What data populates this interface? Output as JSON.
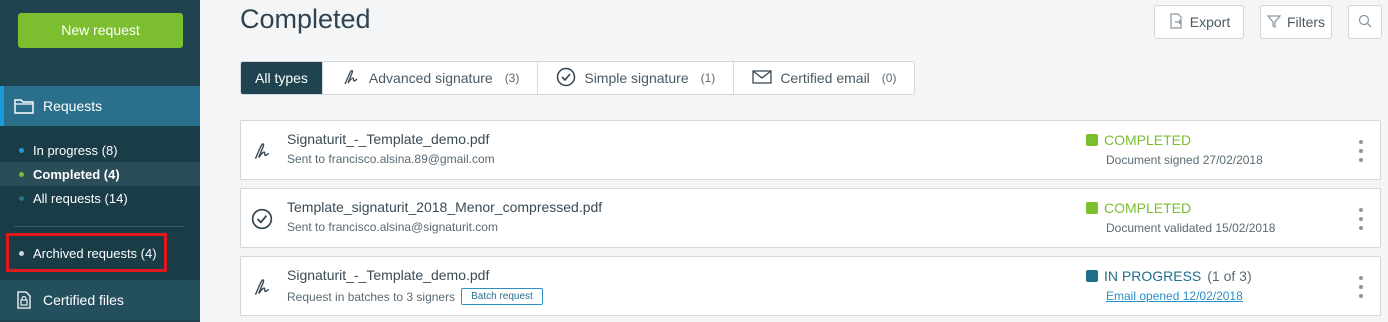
{
  "sidebar": {
    "new_request": "New request",
    "requests_label": "Requests",
    "items": [
      {
        "label": "In progress (8)",
        "dot_color": "#1a9bd7"
      },
      {
        "label": "Completed (4)",
        "dot_color": "#7bbe2f"
      },
      {
        "label": "All requests (14)",
        "dot_color": "#2a6f8c"
      }
    ],
    "archived": {
      "label": "Archived requests (4)",
      "dot_color": "#d0d6da"
    },
    "certified_files": "Certified files"
  },
  "header": {
    "title": "Completed",
    "export_label": "Export",
    "filters_label": "Filters"
  },
  "tabs": [
    {
      "label": "All types",
      "count": "",
      "icon": "all-types"
    },
    {
      "label": "Advanced signature",
      "count": "(3)",
      "icon": "signature-icon"
    },
    {
      "label": "Simple signature",
      "count": "(1)",
      "icon": "check-circle-icon"
    },
    {
      "label": "Certified email",
      "count": "(0)",
      "icon": "envelope-icon"
    }
  ],
  "rows": [
    {
      "icon": "signature-icon",
      "filename": "Signaturit_-_Template_demo.pdf",
      "sub": "Sent to francisco.alsina.89@gmail.com",
      "status": "COMPLETED",
      "status_color": "#7bbe2f",
      "detail": "Document signed 27/02/2018"
    },
    {
      "icon": "check-circle-icon",
      "filename": "Template_signaturit_2018_Menor_compressed.pdf",
      "sub": "Sent to francisco.alsina@signaturit.com",
      "status": "COMPLETED",
      "status_color": "#7bbe2f",
      "detail": "Document validated 15/02/2018"
    },
    {
      "icon": "signature-icon",
      "filename": "Signaturit_-_Template_demo.pdf",
      "sub": "Request in batches to 3 signers",
      "badge": "Batch request",
      "status": "IN PROGRESS",
      "status_extra": "(1 of 3)",
      "status_color": "#1f6f8c",
      "detail": "Email opened 12/02/2018"
    }
  ]
}
